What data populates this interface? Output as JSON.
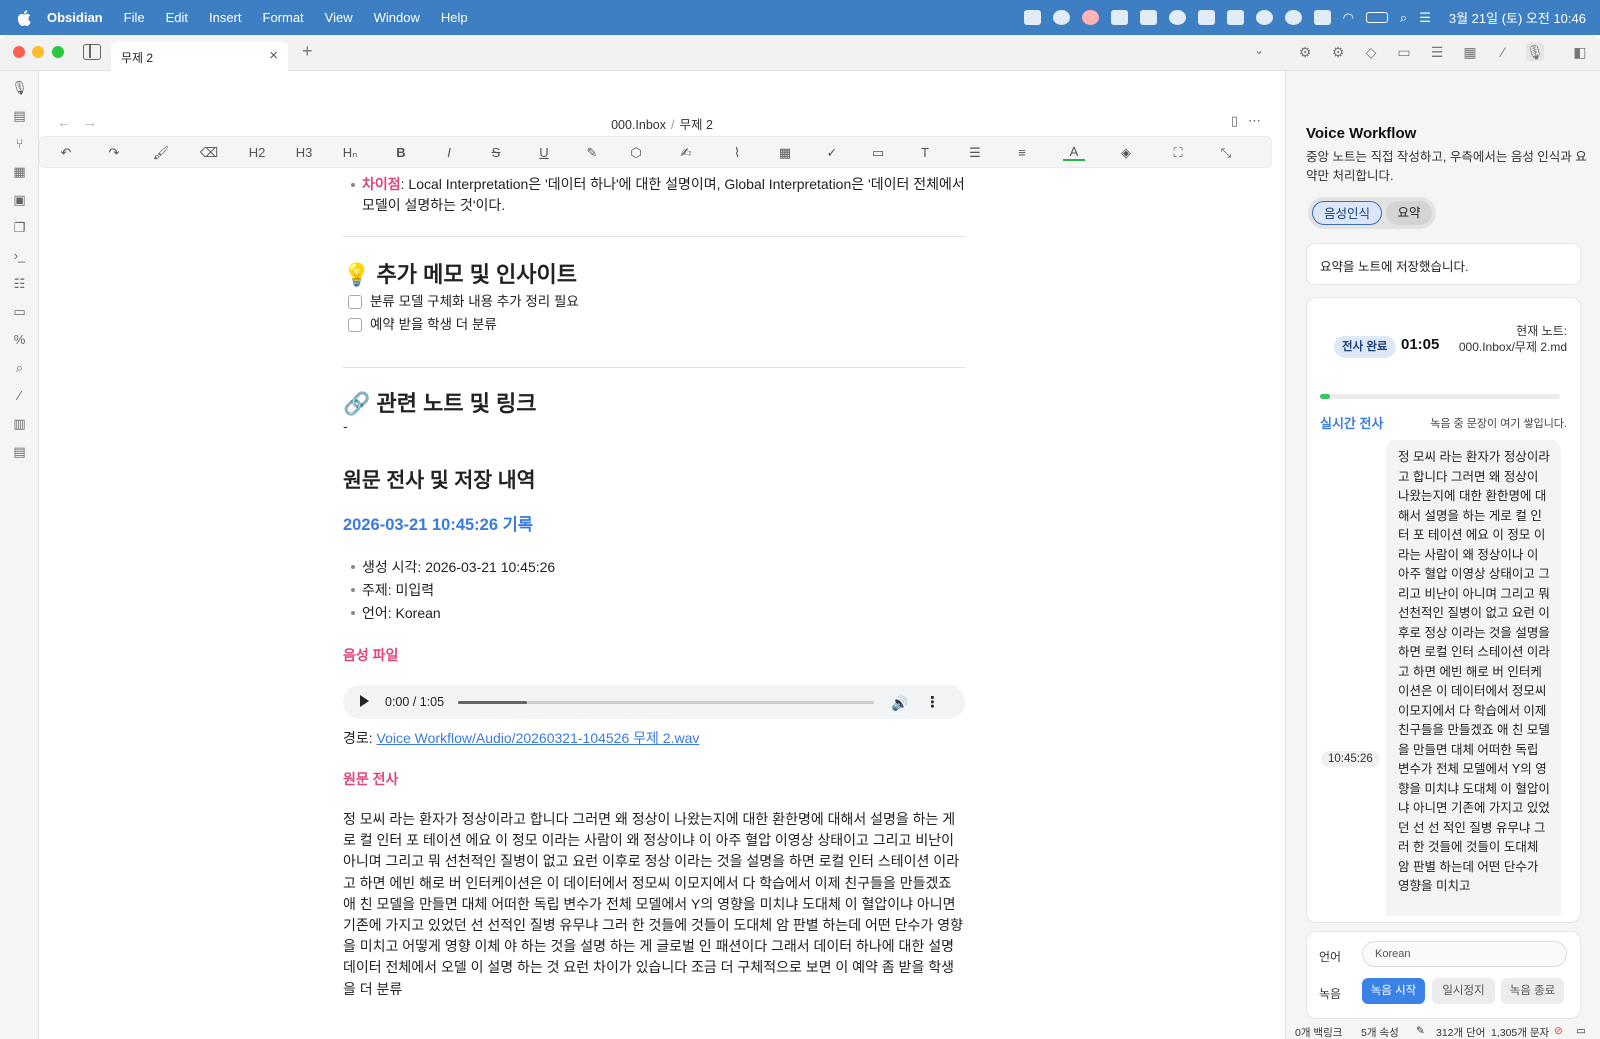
{
  "menubar": {
    "app": "Obsidian",
    "items": [
      "File",
      "Edit",
      "Insert",
      "Format",
      "View",
      "Window",
      "Help"
    ],
    "clock": "3월 21일 (토) 오전 10:46"
  },
  "tabs": {
    "active_label": "무제 2"
  },
  "breadcrumb": {
    "folder": "000.Inbox",
    "separator": "/",
    "note": "무제 2"
  },
  "toolbar": {
    "h2": "H2",
    "h3": "H3",
    "hn": "Hₙ",
    "bold": "B",
    "italic": "I",
    "strike": "S",
    "underline": "U",
    "text_color": "A"
  },
  "doc": {
    "diff_label": "차이점",
    "diff_text": ": Local Interpretation은 '데이터 하나'에 대한 설명이며, Global Interpretation은 '데이터 전체에서 모델이 설명하는 것'이다.",
    "memo_heading": "💡 추가 메모 및 인사이트",
    "checklist": [
      "분류 모델 구체화 내용 추가 정리 필요",
      "예약 받을 학생 더 분류"
    ],
    "links_heading": "🔗 관련 노트 및 링크",
    "links_text": "-",
    "record_heading": "원문 전사 및 저장 내역",
    "record_subheading": "2026-03-21 10:45:26 기록",
    "meta": [
      "생성 시각: 2026-03-21 10:45:26",
      "주제: 미입력",
      "언어: Korean"
    ],
    "audio_label": "음성 파일",
    "audio_time": "0:00 / 1:05",
    "audio_progress": 0.165,
    "path_label": "경로:",
    "path_link": "Voice Workflow/Audio/20260321-104526 무제 2.wav",
    "transcript_label": "원문 전사",
    "transcript": "정 모씨 라는 환자가 정상이라고 합니다 그러면 왜 정상이 나왔는지에 대한 환한명에 대해서 설명을 하는 게로 컬 인터 포 테이션 에요 이 정모 이라는 사람이 왜 정상이냐 이 아주 혈압 이영상 상태이고 그리고 비난이 아니며 그리고 뭐 선천적인 질병이 없고 요런 이후로 정상 이라는 것을 설명을 하면 로컬 인터 스테이션 이라고 하면 에빈 해로 버 인터케이션은 이 데이터에서 정모씨 이모지에서 다 학습에서 이제 친구들을 만들겠죠 애 친 모델을 만들면 대체 어떠한 독립 변수가 전체 모델에서 Y의 영향을 미치냐 도대체 이 혈압이냐 아니면 기존에 가지고 있었던 선 선적인 질병 유무냐 그러 한 것들에 것들이 도대체 암 판별 하는데 어떤 단수가 영향을 미치고 어떻게 영향 이체 야 하는 것을 설명 하는 게 글로벌 인 패션이다 그래서 데이터 하나에 대한 설명 데이터 전체에서 오델 이 설명 하는 것 요런 차이가 있습니다 조금 더 구체적으로 보면 이 예약 좀 받을 학생을 더 분류"
  },
  "panel": {
    "title": "Voice Workflow",
    "description": "중앙 노트는 직접 작성하고, 우측에서는 음성 인식과 요약만 처리합니다.",
    "tab_voice": "음성인식",
    "tab_summary": "요약",
    "status_message": "요약을 노트에 저장했습니다.",
    "badge": "전사 완료",
    "elapsed": "01:05",
    "current_note": "현재 노트: 000.Inbox/무제 2.md",
    "progress": 0.04,
    "live_label": "실시간 전사",
    "live_hint": "녹음 중 문장이 여기 쌓입니다.",
    "line_time": "10:45:26",
    "live_text": "정 모씨 라는 환자가 정상이라고 합니다 그러면 왜 정상이 나왔는지에 대한 환한명에 대해서 설명을 하는 게로 컬 인터 포 테이션 에요 이 정모 이라는 사람이 왜 정상이나 이 아주 혈압 이영상 상태이고 그리고 비난이 아니며 그리고 뭐 선천적인 질병이 없고 요런 이후로 정상 이라는 것을 설명을 하면 로컬 인터 스테이션 이라고 하면 에빈 해로 버 인터케이션은 이 데이터에서 정모씨 이모지에서 다 학습에서 이제 친구들을 만들겠죠 애 친 모델을 만들면 대체 어떠한 독립 변수가 전체 모델에서 Y의 영향을 미치냐 도대체 이 혈압이냐 아니면 기존에 가지고 있었던 선 선 적인 질병 유무냐 그러 한 것들에 것들이 도대체 암 판별 하는데 어떤 단수가 영향을 미치고",
    "lang_label": "언어",
    "lang_value": "Korean",
    "rec_label": "녹음",
    "btn_start": "녹음 시작",
    "btn_pause": "일시정지",
    "btn_stop": "녹음 종료"
  },
  "statusbar": {
    "backlinks": "0개 백링크",
    "properties": "5개 속성",
    "words": "312개 단어",
    "chars": "1,305개 문자"
  },
  "colors": {
    "menubar": "#3e7fc4",
    "accent_blue": "#3a7be0",
    "accent_pink": "#e0457b",
    "record_green": "#34c759"
  }
}
